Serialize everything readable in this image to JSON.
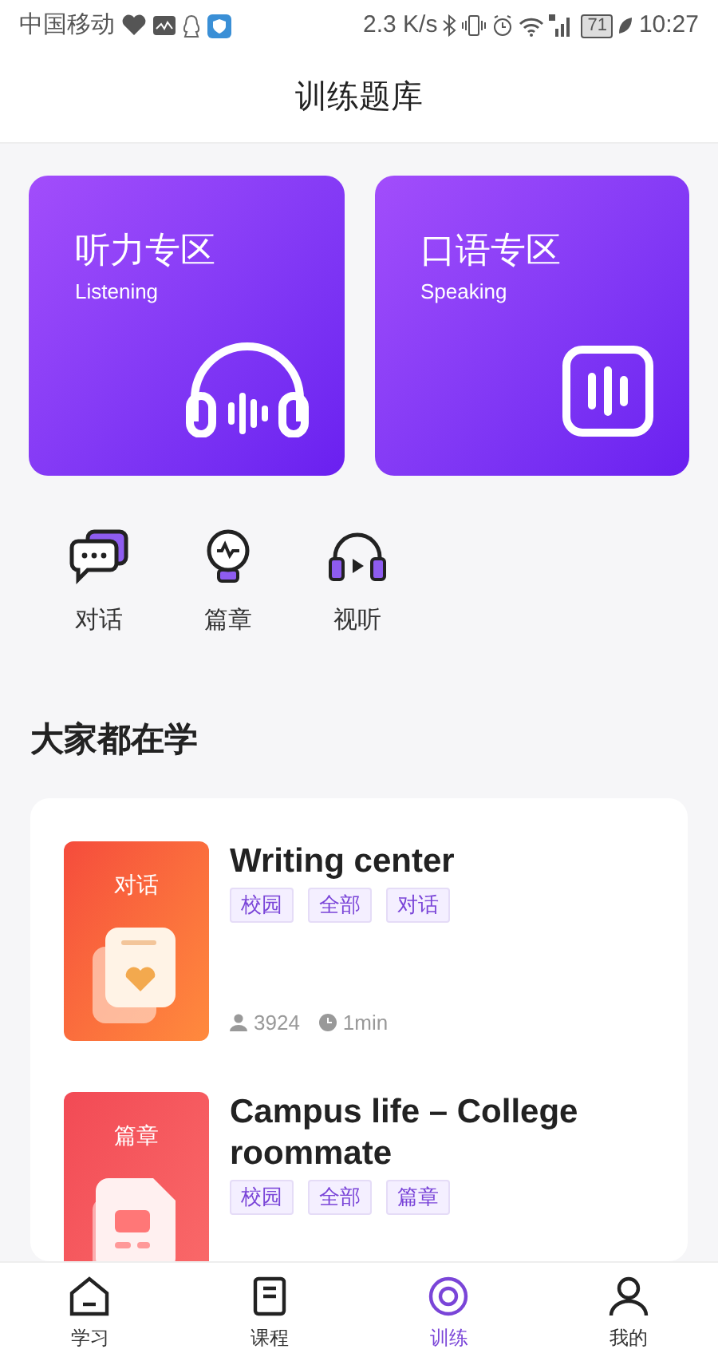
{
  "status_bar": {
    "carrier": "中国移动",
    "speed": "2.3 K/s",
    "battery": "71",
    "time": "10:27"
  },
  "header": {
    "title": "训练题库"
  },
  "zones": [
    {
      "title": "听力专区",
      "subtitle": "Listening",
      "kind": "headphones"
    },
    {
      "title": "口语专区",
      "subtitle": "Speaking",
      "kind": "voice"
    }
  ],
  "categories": [
    {
      "label": "对话",
      "kind": "chat"
    },
    {
      "label": "篇章",
      "kind": "bulb"
    },
    {
      "label": "视听",
      "kind": "headset"
    }
  ],
  "section_title": "大家都在学",
  "courses": [
    {
      "cover_label": "对话",
      "kind": "dialog",
      "title": "Writing center",
      "tags": [
        "校园",
        "全部",
        "对话"
      ],
      "learners": "3924",
      "duration": "1min"
    },
    {
      "cover_label": "篇章",
      "kind": "article",
      "title": "Campus life – College roommate",
      "tags": [
        "校园",
        "全部",
        "篇章"
      ]
    }
  ],
  "nav": [
    {
      "label": "学习",
      "selected": false,
      "kind": "home"
    },
    {
      "label": "课程",
      "selected": false,
      "kind": "book"
    },
    {
      "label": "训练",
      "selected": true,
      "kind": "train"
    },
    {
      "label": "我的",
      "selected": false,
      "kind": "user"
    }
  ]
}
